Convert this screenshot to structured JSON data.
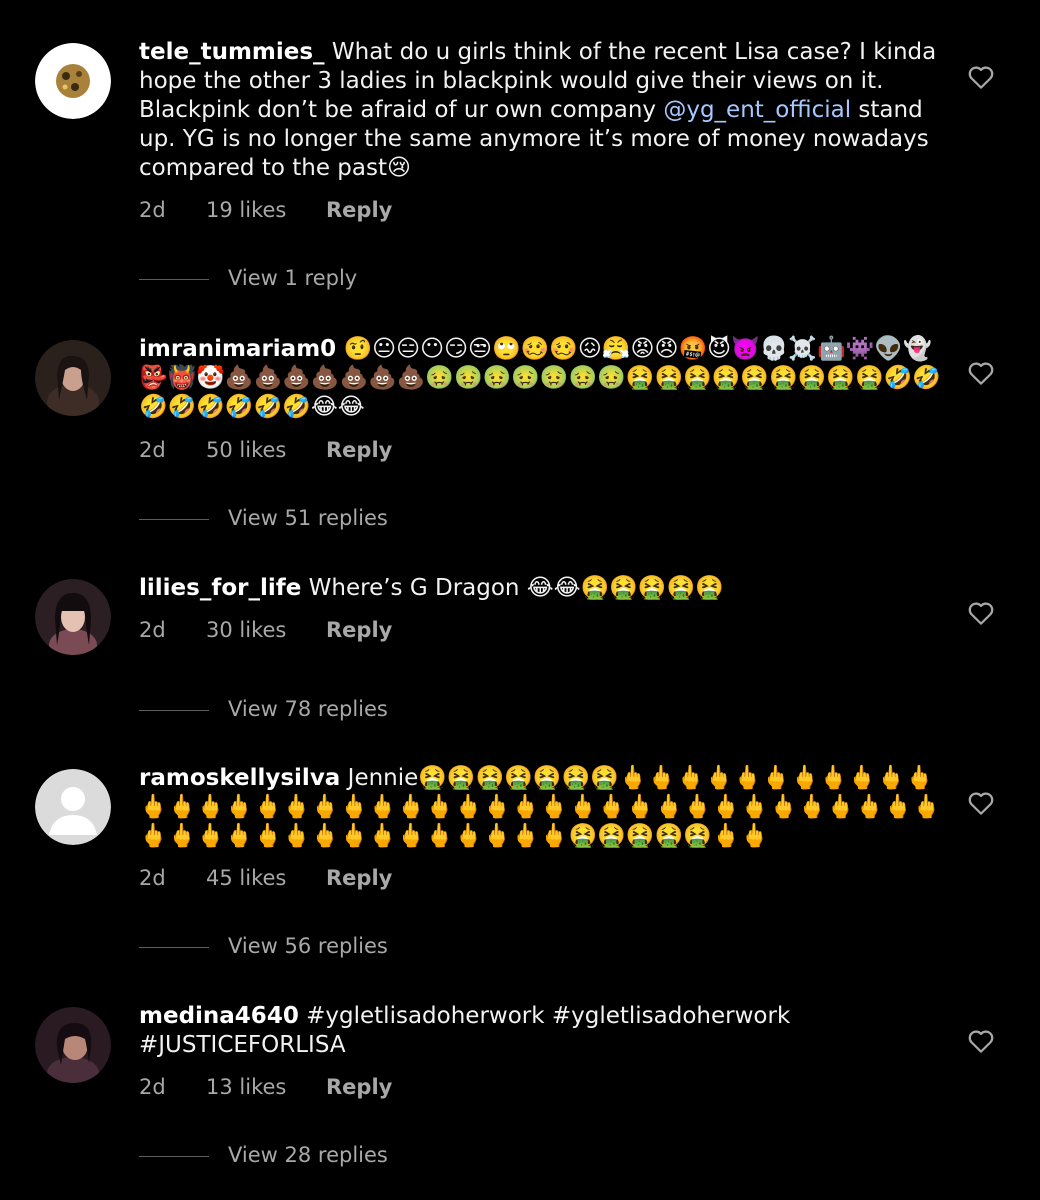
{
  "colors": {
    "background": "#000000",
    "text": "#f2f2f2",
    "secondary": "#a8a8a8",
    "mention": "#a7c8ff"
  },
  "comments": [
    {
      "username": "tele_tummies_",
      "text_before": "What do u girls think of the recent Lisa case? I kinda hope the other 3 ladies in blackpink would give their views on it. Blackpink don’t be afraid of ur own company ",
      "mention": "@yg_ent_official",
      "text_after": " stand up. YG is no longer the same anymore it’s more of money nowadays compared to the past😢",
      "time": "2d",
      "likes": "19 likes",
      "reply_label": "Reply",
      "view_replies": "View 1 reply"
    },
    {
      "username": "imranimariam0",
      "text": "🤨😐😑😶😏😒🙄🥴🥴😖😤😡😠🤬😈👿💀☠️🤖👾👽👻👺👹🤡💩💩💩💩💩💩💩🤢🤢🤢🤢🤢🤢🤢🤮🤮🤮🤮🤮🤮🤮🤮🤮🤣🤣🤣🤣🤣🤣🤣🤣😂😂",
      "time": "2d",
      "likes": "50 likes",
      "reply_label": "Reply",
      "view_replies": "View 51 replies"
    },
    {
      "username": "lilies_for_life",
      "text": "Where’s G Dragon 😂😂🤮🤮🤮🤮🤮",
      "time": "2d",
      "likes": "30 likes",
      "reply_label": "Reply",
      "view_replies": "View 78 replies"
    },
    {
      "username": "ramoskellysilva",
      "text": "Jennie🤮🤮🤮🤮🤮🤮🤮🖕🖕🖕🖕🖕🖕🖕🖕🖕🖕🖕🖕🖕🖕🖕🖕🖕🖕🖕🖕🖕🖕🖕🖕🖕🖕🖕🖕🖕🖕🖕🖕🖕🖕🖕🖕🖕🖕🖕🖕🖕🖕🖕🖕🖕🖕🖕🖕🖕🖕🖕🖕🖕🖕🤮🤮🤮🤮🤮🖕🖕",
      "time": "2d",
      "likes": "45 likes",
      "reply_label": "Reply",
      "view_replies": "View 56 replies"
    },
    {
      "username": "medina4640",
      "text": "#ygletlisadoherwork #ygletlisadoherwork #JUSTICEFORLISA",
      "time": "2d",
      "likes": "13 likes",
      "reply_label": "Reply",
      "view_replies": "View 28 replies"
    }
  ]
}
